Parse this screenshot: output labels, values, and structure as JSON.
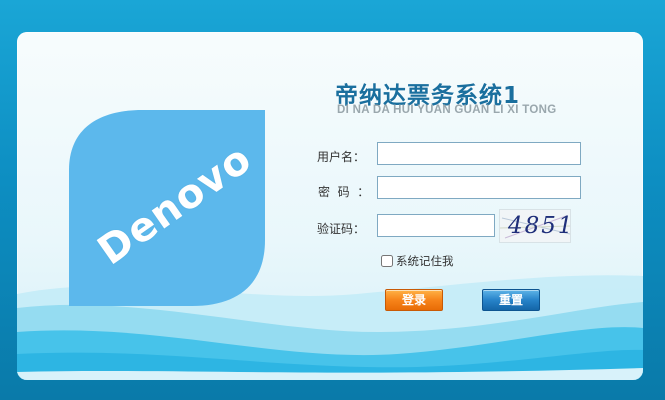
{
  "logo": {
    "text": "Denovo",
    "icon": "denovo-leaf-logo"
  },
  "header": {
    "title": "帝纳达票务系统1",
    "subtitle": "DI NA DA HUI YUAN GUAN LI XI TONG"
  },
  "form": {
    "username_label": "用户名：",
    "username_value": "",
    "password_label": "密  码  ：",
    "password_value": "",
    "captcha_label": "验证码：",
    "captcha_value": "",
    "captcha_image_text": "4851",
    "remember_label": "系统记住我",
    "remember_checked": false
  },
  "buttons": {
    "login_label": "登录",
    "reset_label": "重置"
  },
  "colors": {
    "background": "#0d8ec2",
    "title": "#1a6f9e",
    "logo_fill": "#5cb8ec",
    "login_button": "#f7841a",
    "reset_button": "#2783c9"
  }
}
